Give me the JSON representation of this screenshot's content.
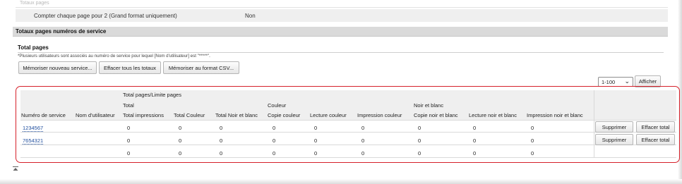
{
  "previous_section": {
    "faded_title": "Totaux pages",
    "setting_label": "Compter chaque page pour 2 (Grand format uniquement)",
    "setting_value": "Non"
  },
  "service_section": {
    "header": "Totaux pages numéros de service",
    "subtitle": "Total pages",
    "note": "*Plusieurs utilisateurs sont associés au numéro de service pour lequel [Nom d'utilisateur] est \"*****\".",
    "buttons": {
      "store_new": "Mémoriser nouveau service...",
      "clear_all": "Effacer tous les totaux",
      "store_csv": "Mémoriser au format CSV..."
    }
  },
  "pagination": {
    "range_value": "1-100",
    "display_button": "Afficher"
  },
  "table": {
    "group_header": "Total pages/Limite pages",
    "subgroup_total": "Total",
    "subgroup_color": "Couleur",
    "subgroup_bw": "Noir et blanc",
    "columns": {
      "service_number": "Numéro de service",
      "user_name": "Nom d'utilisateur",
      "total_impressions": "Total impressions",
      "total_couleur": "Total Couleur",
      "total_nb": "Total Noir et blanc",
      "copie_couleur": "Copie couleur",
      "lecture_couleur": "Lecture couleur",
      "impression_couleur": "Impression couleur",
      "copie_nb": "Copie noir et blanc",
      "lecture_nb": "Lecture noir et blanc",
      "impression_nb": "Impression noir et blanc"
    },
    "rows": [
      {
        "service": "1234567",
        "user": "",
        "values": [
          "0",
          "0",
          "0",
          "0",
          "0",
          "0",
          "0",
          "0",
          "0"
        ],
        "delete": "Supprimer",
        "clear": "Effacer total"
      },
      {
        "service": "7654321",
        "user": "",
        "values": [
          "0",
          "0",
          "0",
          "0",
          "0",
          "0",
          "0",
          "0",
          "0"
        ],
        "delete": "Supprimer",
        "clear": "Effacer total"
      },
      {
        "service": "",
        "user": "",
        "values": [
          "0",
          "0",
          "0",
          "0",
          "0",
          "0",
          "0",
          "0",
          "0"
        ],
        "delete": "",
        "clear": ""
      }
    ]
  },
  "scroll_top_icon": "scroll-to-top-icon",
  "colors": {
    "highlight_border": "#d6202a",
    "link": "#1f4e9e",
    "header_bg": "#efefef",
    "section_header_bg": "#dadada"
  }
}
